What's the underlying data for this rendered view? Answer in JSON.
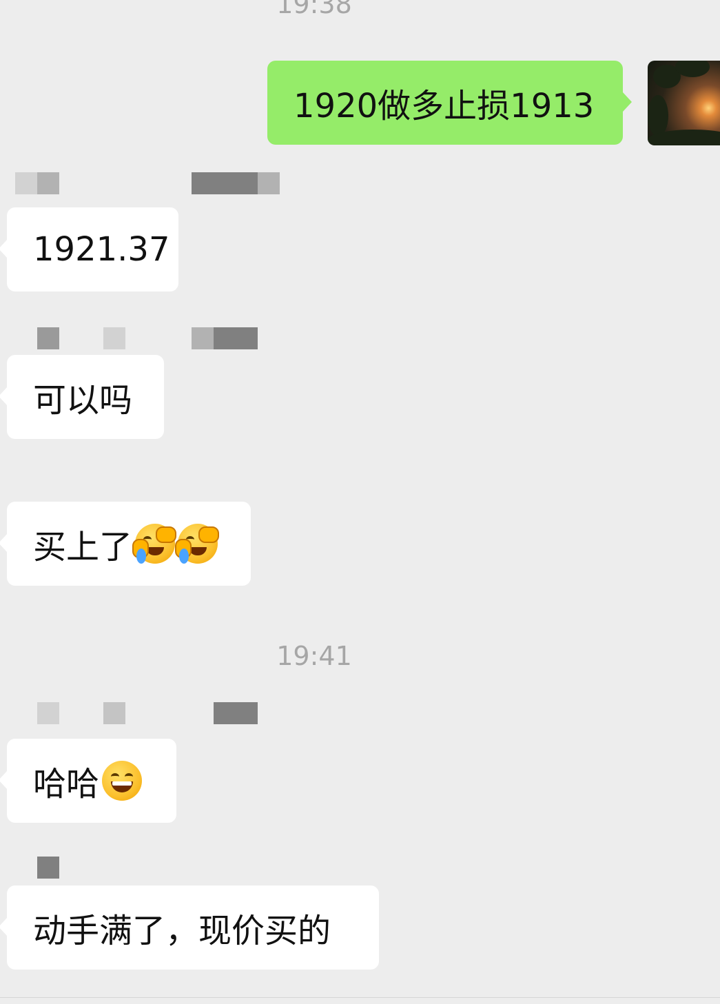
{
  "timestamps": {
    "top": "19:38",
    "middle": "19:41"
  },
  "messages": [
    {
      "direction": "outgoing",
      "text": "1920做多止损1913"
    },
    {
      "direction": "incoming",
      "text": "1921.37"
    },
    {
      "direction": "incoming",
      "text": "可以吗"
    },
    {
      "direction": "incoming",
      "text": "买上了",
      "emoji": [
        "face-palm-crying-emoji",
        "face-palm-crying-emoji"
      ]
    },
    {
      "direction": "incoming",
      "text": "哈哈",
      "emoji": [
        "grinning-face-emoji"
      ]
    },
    {
      "direction": "incoming",
      "text": "动手满了，现价买的"
    }
  ],
  "avatar": {
    "icon": "sunset-photo-avatar"
  },
  "colors": {
    "background": "#ededed",
    "outgoing_bubble": "#95ec69",
    "incoming_bubble": "#ffffff",
    "timestamp_text": "#a6a6a6"
  }
}
